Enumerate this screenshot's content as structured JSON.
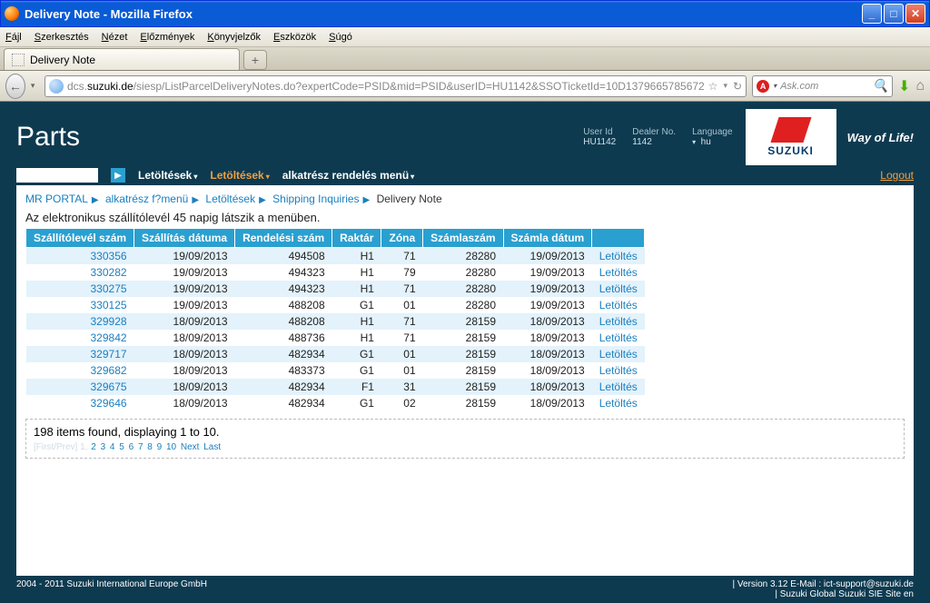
{
  "window": {
    "title": "Delivery Note - Mozilla Firefox"
  },
  "ff_menu": [
    "Fájl",
    "Szerkesztés",
    "Nézet",
    "Előzmények",
    "Könyvjelzők",
    "Eszközök",
    "Súgó"
  ],
  "tab": {
    "label": "Delivery Note"
  },
  "url": {
    "host": "suzuki.de",
    "pre": "dcs.",
    "path": "/siesp/ListParcelDeliveryNotes.do?expertCode=PSID&mid=PSID&userID=HU1142&SSOTicketId=10D1379665785672"
  },
  "search": {
    "placeholder": "Ask.com"
  },
  "parts_title": "Parts",
  "hdr": {
    "userid_lbl": "User Id",
    "userid": "HU1142",
    "dealer_lbl": "Dealer No.",
    "dealer": "1142",
    "lang_lbl": "Language",
    "lang": "hu"
  },
  "logo_text": "SUZUKI",
  "way": "Way of Life!",
  "menu": {
    "let1": "Letöltések",
    "let2": "Letöltések",
    "alk": "alkatrész rendelés menü"
  },
  "logout": "Logout",
  "breadcrumb": {
    "a": "MR PORTAL",
    "b": "alkatrész f?menü",
    "c": "Letöltések",
    "d": "Shipping Inquiries",
    "cur": "Delivery Note"
  },
  "info": "Az elektronikus szállítólevél 45 napig látszik a menüben.",
  "columns": [
    "Szállítólevél szám",
    "Szállítás dátuma",
    "Rendelési szám",
    "Raktár",
    "Zóna",
    "Számlaszám",
    "Számla dátum",
    ""
  ],
  "rows": [
    {
      "sl": "330356",
      "sd": "19/09/2013",
      "rs": "494508",
      "rk": "H1",
      "z": "71",
      "sz": "28280",
      "szd": "19/09/2013",
      "dl": "Letöltés"
    },
    {
      "sl": "330282",
      "sd": "19/09/2013",
      "rs": "494323",
      "rk": "H1",
      "z": "79",
      "sz": "28280",
      "szd": "19/09/2013",
      "dl": "Letöltés"
    },
    {
      "sl": "330275",
      "sd": "19/09/2013",
      "rs": "494323",
      "rk": "H1",
      "z": "71",
      "sz": "28280",
      "szd": "19/09/2013",
      "dl": "Letöltés"
    },
    {
      "sl": "330125",
      "sd": "19/09/2013",
      "rs": "488208",
      "rk": "G1",
      "z": "01",
      "sz": "28280",
      "szd": "19/09/2013",
      "dl": "Letöltés"
    },
    {
      "sl": "329928",
      "sd": "18/09/2013",
      "rs": "488208",
      "rk": "H1",
      "z": "71",
      "sz": "28159",
      "szd": "18/09/2013",
      "dl": "Letöltés"
    },
    {
      "sl": "329842",
      "sd": "18/09/2013",
      "rs": "488736",
      "rk": "H1",
      "z": "71",
      "sz": "28159",
      "szd": "18/09/2013",
      "dl": "Letöltés"
    },
    {
      "sl": "329717",
      "sd": "18/09/2013",
      "rs": "482934",
      "rk": "G1",
      "z": "01",
      "sz": "28159",
      "szd": "18/09/2013",
      "dl": "Letöltés"
    },
    {
      "sl": "329682",
      "sd": "18/09/2013",
      "rs": "483373",
      "rk": "G1",
      "z": "01",
      "sz": "28159",
      "szd": "18/09/2013",
      "dl": "Letöltés"
    },
    {
      "sl": "329675",
      "sd": "18/09/2013",
      "rs": "482934",
      "rk": "F1",
      "z": "31",
      "sz": "28159",
      "szd": "18/09/2013",
      "dl": "Letöltés"
    },
    {
      "sl": "329646",
      "sd": "18/09/2013",
      "rs": "482934",
      "rk": "G1",
      "z": "02",
      "sz": "28159",
      "szd": "18/09/2013",
      "dl": "Letöltés"
    }
  ],
  "pager": {
    "summary": "198 items found, displaying 1 to 10.",
    "dim": "[First/Prev] 1,",
    "pages": [
      "2",
      "3",
      "4",
      "5",
      "6",
      "7",
      "8",
      "9",
      "10"
    ],
    "next": "Next",
    "last": "Last"
  },
  "footer": {
    "left": "2004 - 2011 Suzuki International Europe GmbH",
    "r1": "|  Version 3.12  E-Mail : ict-support@suzuki.de",
    "r2": "|       Suzuki Global Suzuki SIE Site en"
  }
}
